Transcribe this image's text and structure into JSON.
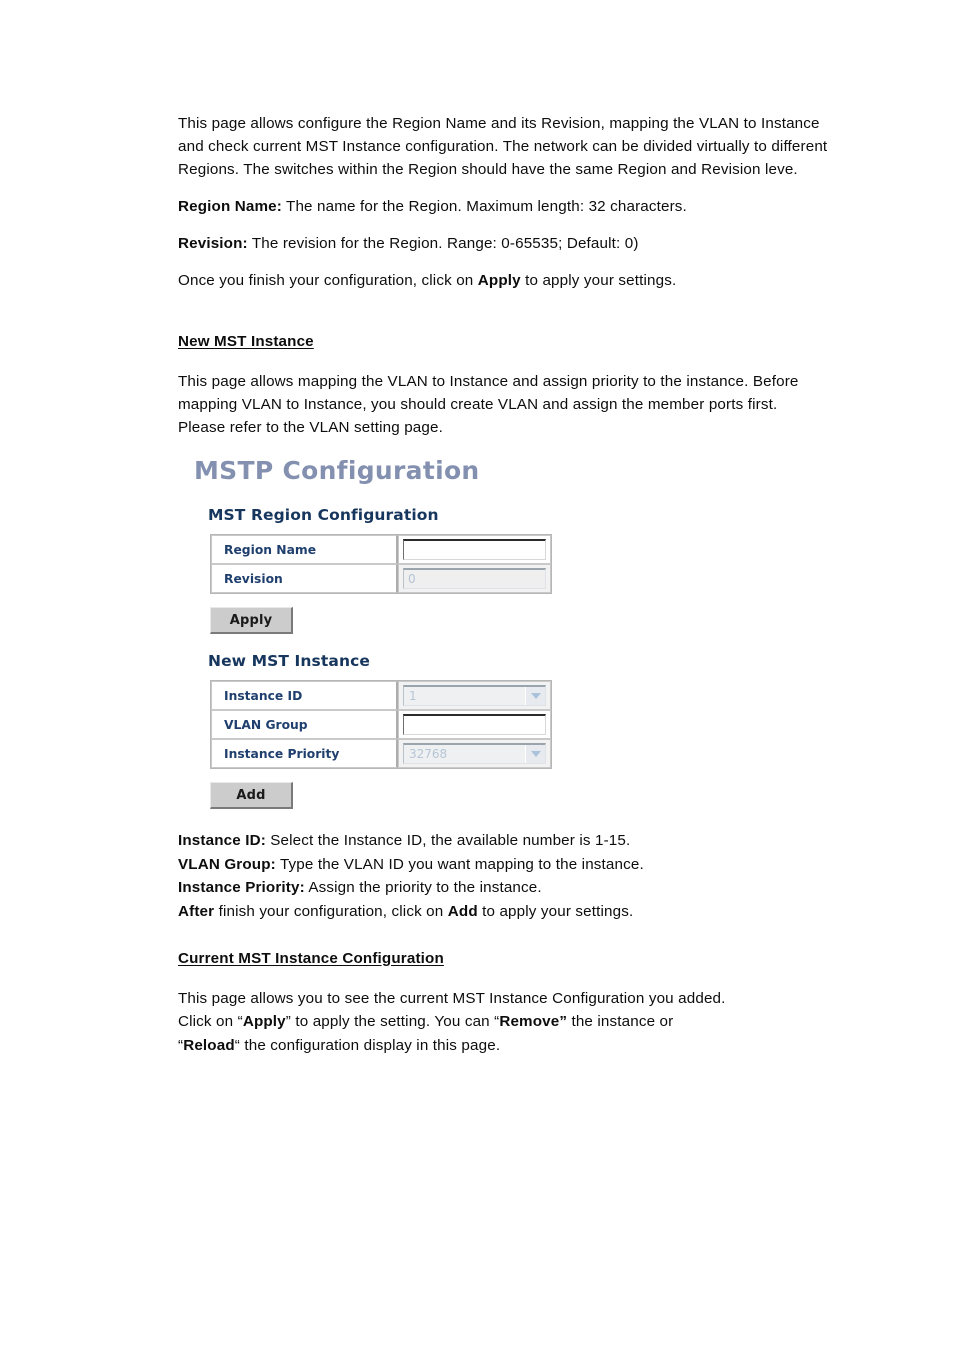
{
  "document": {
    "intro_paragraph": "This page allows configure the Region Name and its Revision, mapping the VLAN to Instance and check current MST Instance configuration. The network can be divided virtually to different Regions. The switches within the Region should have the same Region and Revision leve.",
    "region_name_term": "Region Name:",
    "region_name_desc": " The name for the Region. Maximum length: 32 characters.",
    "revision_term": "Revision:",
    "revision_desc": " The revision for the Region. Range: 0-65535; Default: 0)",
    "apply_note_pre": "Once you finish your configuration, click on ",
    "apply_note_bold": "Apply",
    "apply_note_post": " to apply your settings.",
    "new_mst_heading": "New MST Instance",
    "new_mst_paragraph": "This page allows mapping the VLAN to Instance and assign priority to the instance. Before mapping VLAN to Instance, you should create VLAN and assign the member ports first. Please refer to the VLAN setting page.",
    "instance_id_term": "Instance ID:",
    "instance_id_desc": " Select the Instance ID, the available number is 1-15.",
    "vlan_group_term": "VLAN Group:",
    "vlan_group_desc": " Type the VLAN ID you want mapping to the instance.",
    "instance_priority_term": "Instance Priority:",
    "instance_priority_desc": " Assign the priority to the instance.",
    "after_term": "After",
    "after_desc_pre": " finish your configuration, click on ",
    "after_desc_bold": "Add",
    "after_desc_post": " to apply your settings.",
    "current_mst_heading": "Current MST Instance Configuration",
    "current_mst_line1": "This page allows you to see the current MST Instance Configuration you added.",
    "current_mst_line2_a": "Click on “",
    "current_mst_line2_apply": "Apply",
    "current_mst_line2_b": "” to apply the setting. You can “",
    "current_mst_line2_remove": "Remove”",
    "current_mst_line2_c": " the instance or",
    "current_mst_line3_a": "“",
    "current_mst_line3_reload": "Reload",
    "current_mst_line3_b": "“ the configuration display in this page."
  },
  "device_ui": {
    "page_title": "MSTP Configuration",
    "region_section": {
      "heading": "MST Region Configuration",
      "rows": [
        {
          "label": "Region Name",
          "value": "",
          "kind": "text",
          "disabled": false
        },
        {
          "label": "Revision",
          "value": "0",
          "kind": "text",
          "disabled": true
        }
      ],
      "button_label": "Apply"
    },
    "instance_section": {
      "heading": "New MST Instance",
      "rows": [
        {
          "label": "Instance ID",
          "value": "1",
          "kind": "select",
          "disabled": true
        },
        {
          "label": "VLAN Group",
          "value": "",
          "kind": "text",
          "disabled": false
        },
        {
          "label": "Instance Priority",
          "value": "32768",
          "kind": "select",
          "disabled": true
        }
      ],
      "button_label": "Add"
    },
    "colors": {
      "page_title": "#8490b0",
      "section_heading": "#17365d",
      "row_label": "#1f3f6e",
      "button_face": "#cccccc",
      "placeholder": "#b6c6d6"
    }
  }
}
